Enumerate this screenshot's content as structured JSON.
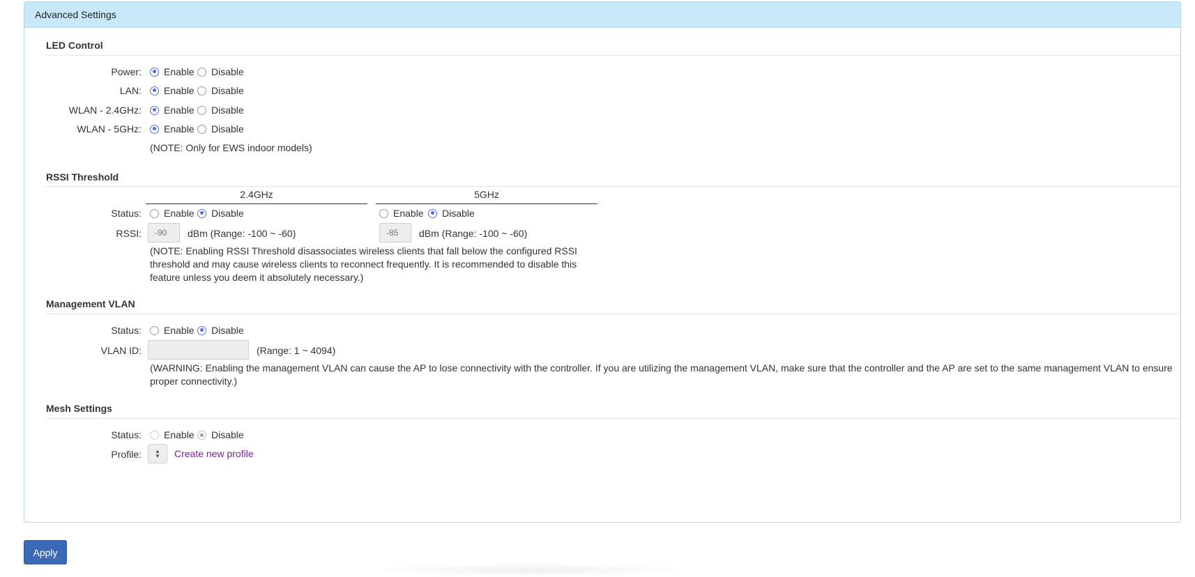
{
  "panel": {
    "title": "Advanced Settings"
  },
  "common": {
    "enable": "Enable",
    "disable": "Disable"
  },
  "led": {
    "title": "LED Control",
    "rows": [
      {
        "label": "Power:",
        "selected": "enable"
      },
      {
        "label": "LAN:",
        "selected": "enable"
      },
      {
        "label": "WLAN - 2.4GHz:",
        "selected": "enable"
      },
      {
        "label": "WLAN - 5GHz:",
        "selected": "enable"
      }
    ],
    "note": "(NOTE: Only for EWS indoor models)"
  },
  "rssi": {
    "title": "RSSI Threshold",
    "col_24": "2.4GHz",
    "col_5": "5GHz",
    "status_label": "Status:",
    "rssi_label": "RSSI:",
    "band_24": {
      "status": "disable",
      "placeholder": "-90"
    },
    "band_5": {
      "status": "disable",
      "placeholder": "-85"
    },
    "range_text": "dBm (Range: -100 ~ -60)",
    "note_lines": [
      "(NOTE: Enabling RSSI Threshold disassociates wireless clients that fall below the configured RSSI",
      "threshold and may cause wireless clients to reconnect frequently. It is recommended to disable this",
      "feature unless you deem it absolutely necessary.)"
    ]
  },
  "vlan": {
    "title": "Management VLAN",
    "status_label": "Status:",
    "status": "disable",
    "id_label": "VLAN ID:",
    "id_value": "",
    "range_text": "(Range: 1 ~ 4094)",
    "warning_lines": [
      "(WARNING: Enabling the management VLAN can cause the AP to lose connectivity with the controller. If you are utilizing the management VLAN, make sure that the controller and the AP are set to the same management VLAN to ensure",
      "proper connectivity.)"
    ]
  },
  "mesh": {
    "title": "Mesh Settings",
    "status_label": "Status:",
    "status": "disable",
    "profile_label": "Profile:",
    "create_link": "Create new profile"
  },
  "apply_label": "Apply",
  "colors": {
    "header_bg": "#c7e9f9",
    "radio_accent": "#4f6cf0",
    "apply_bg": "#3a6ab5",
    "link": "#7b1fa2"
  }
}
